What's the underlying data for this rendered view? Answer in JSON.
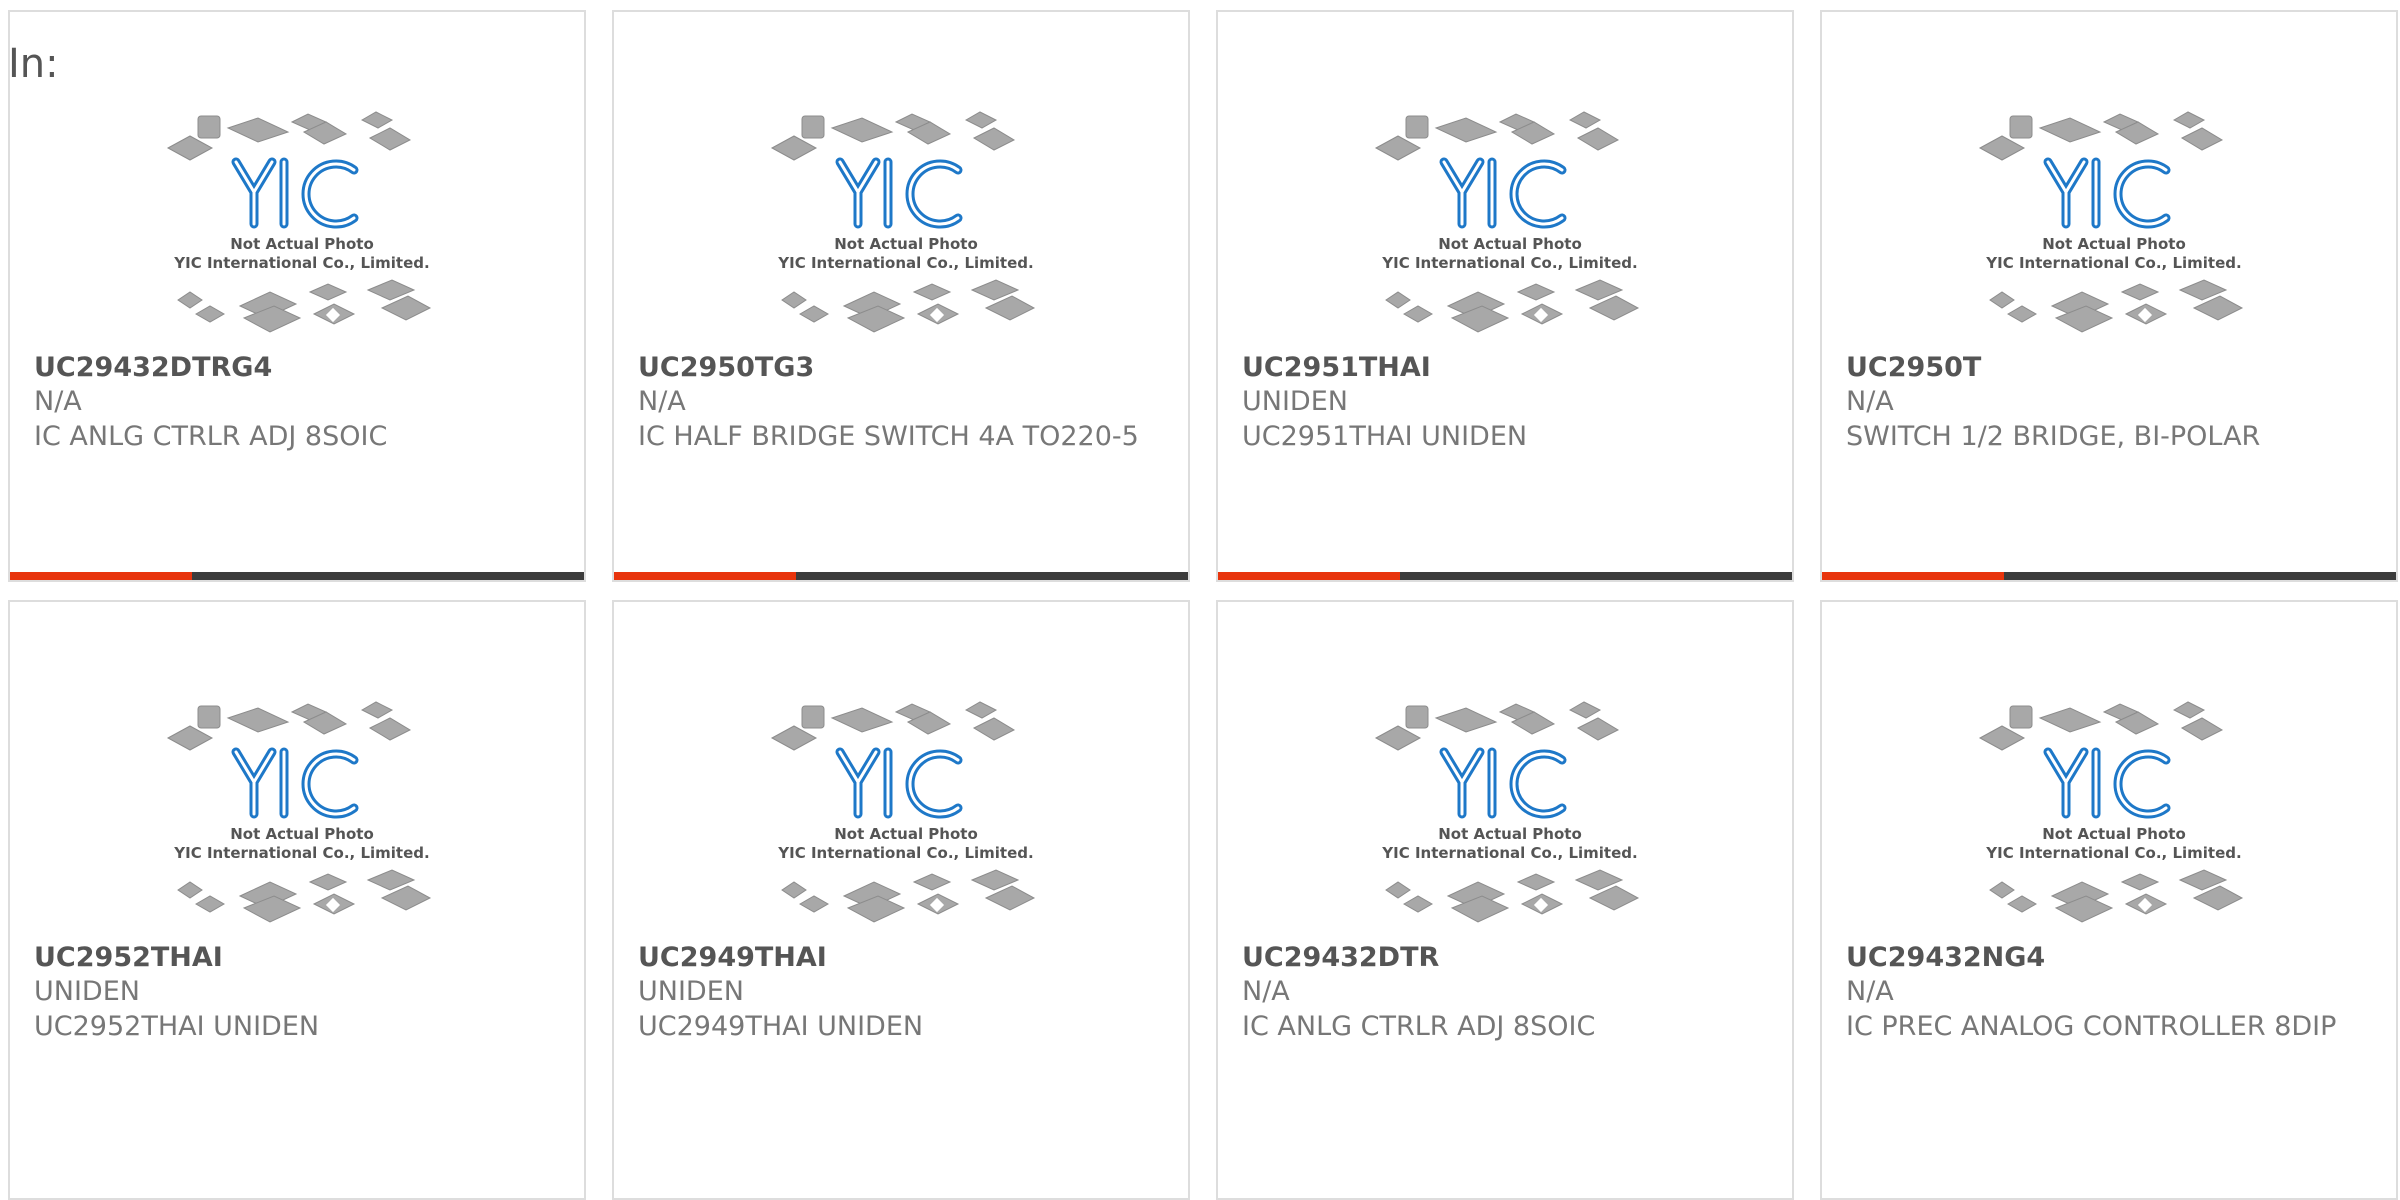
{
  "prefix": "In:",
  "logo": {
    "brand": "YIC",
    "caption_line1": "Not Actual Photo",
    "caption_line2": "YIC International Co., Limited.",
    "brand_color": "#1e78c8"
  },
  "accent_color": "#e8340c",
  "products": [
    {
      "part": "UC29432DTRG4",
      "mfr": "N/A",
      "desc": "IC ANLG CTRLR ADJ 8SOIC"
    },
    {
      "part": "UC2950TG3",
      "mfr": "N/A",
      "desc": "IC HALF BRIDGE SWITCH 4A TO220-5"
    },
    {
      "part": "UC2951THAI",
      "mfr": "UNIDEN",
      "desc": "UC2951THAI UNIDEN"
    },
    {
      "part": "UC2950T",
      "mfr": "N/A",
      "desc": "SWITCH 1/2 BRIDGE, BI-POLAR"
    },
    {
      "part": "UC2952THAI",
      "mfr": "UNIDEN",
      "desc": "UC2952THAI UNIDEN"
    },
    {
      "part": "UC2949THAI",
      "mfr": "UNIDEN",
      "desc": "UC2949THAI UNIDEN"
    },
    {
      "part": "UC29432DTR",
      "mfr": "N/A",
      "desc": "IC ANLG CTRLR ADJ 8SOIC"
    },
    {
      "part": "UC29432NG4",
      "mfr": "N/A",
      "desc": "IC PREC ANALOG CONTROLLER 8DIP"
    }
  ]
}
